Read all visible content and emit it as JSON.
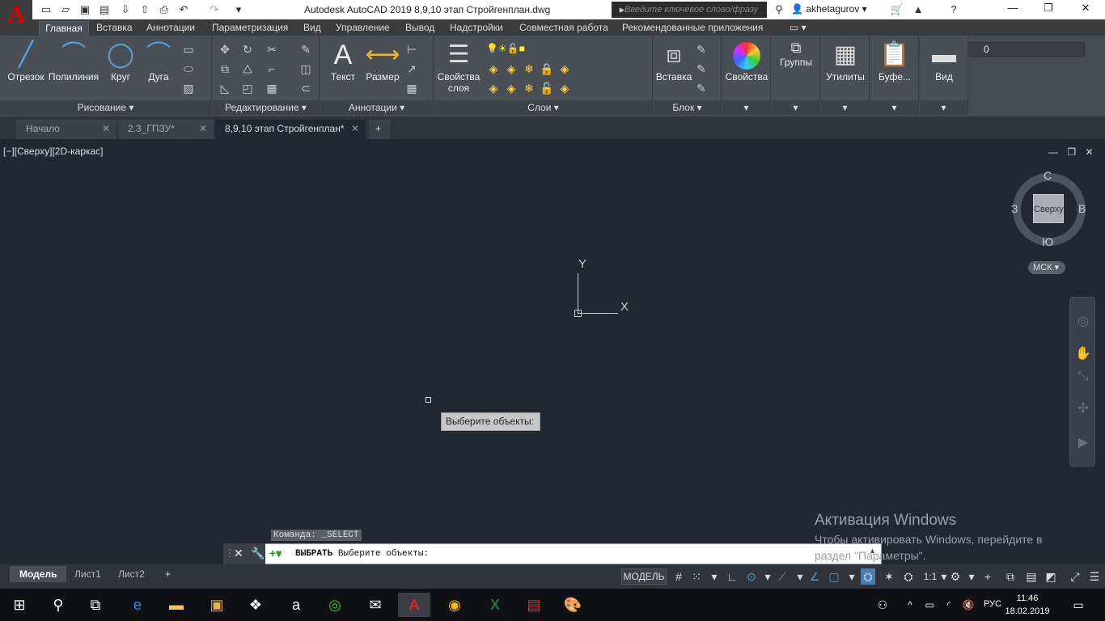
{
  "titlebar": {
    "title": "Autodesk AutoCAD 2019    8,9,10 этап Стройгенплан.dwg",
    "search_placeholder": "Введите ключевое слово/фразу",
    "user": "akhetagurov",
    "logo": "A"
  },
  "ribbon_tabs": [
    "Главная",
    "Вставка",
    "Аннотации",
    "Параметризация",
    "Вид",
    "Управление",
    "Вывод",
    "Надстройки",
    "Совместная работа",
    "Рекомендованные приложения"
  ],
  "panels": {
    "draw": {
      "title": "Рисование",
      "line": "Отрезок",
      "polyline": "Полилиния",
      "circle": "Круг",
      "arc": "Дуга"
    },
    "modify": {
      "title": "Редактирование"
    },
    "annotation": {
      "title": "Аннотации",
      "text": "Текст",
      "dimension": "Размер"
    },
    "layers": {
      "title": "Слои",
      "layer_props": "Свойства\nслоя",
      "current_layer": "0"
    },
    "block": {
      "title": "Блок",
      "insert": "Вставка"
    },
    "properties": "Свойства",
    "groups": "Группы",
    "utilities": "Утилиты",
    "clipboard": "Буфе...",
    "view": "Вид"
  },
  "doc_tabs": [
    "Начало",
    "2.3_ГПЗУ*",
    "8,9,10 этап Стройгенплан*"
  ],
  "viewport": {
    "label": "[−][Сверху][2D-каркас]",
    "cube_face": "Сверху",
    "compass": {
      "n": "С",
      "s": "Ю",
      "e": "В",
      "w": "З"
    },
    "wcs": "МСК",
    "ucs_x": "X",
    "ucs_y": "Y"
  },
  "tooltip": "Выберите объекты:",
  "command": {
    "history": "Команда:  _SELECT",
    "prompt_bold": "ВЫБРАТЬ",
    "prompt": " Выберите объекты:"
  },
  "activation": {
    "title": "Активация Windows",
    "subtitle": "Чтобы активировать Windows, перейдите в раздел \"Параметры\"."
  },
  "layout_tabs": [
    "Модель",
    "Лист1",
    "Лист2"
  ],
  "status": {
    "model": "МОДЕЛЬ",
    "scale": "1:1"
  },
  "taskbar": {
    "lang": "РУС",
    "time": "11:46",
    "date": "18.02.2019"
  }
}
